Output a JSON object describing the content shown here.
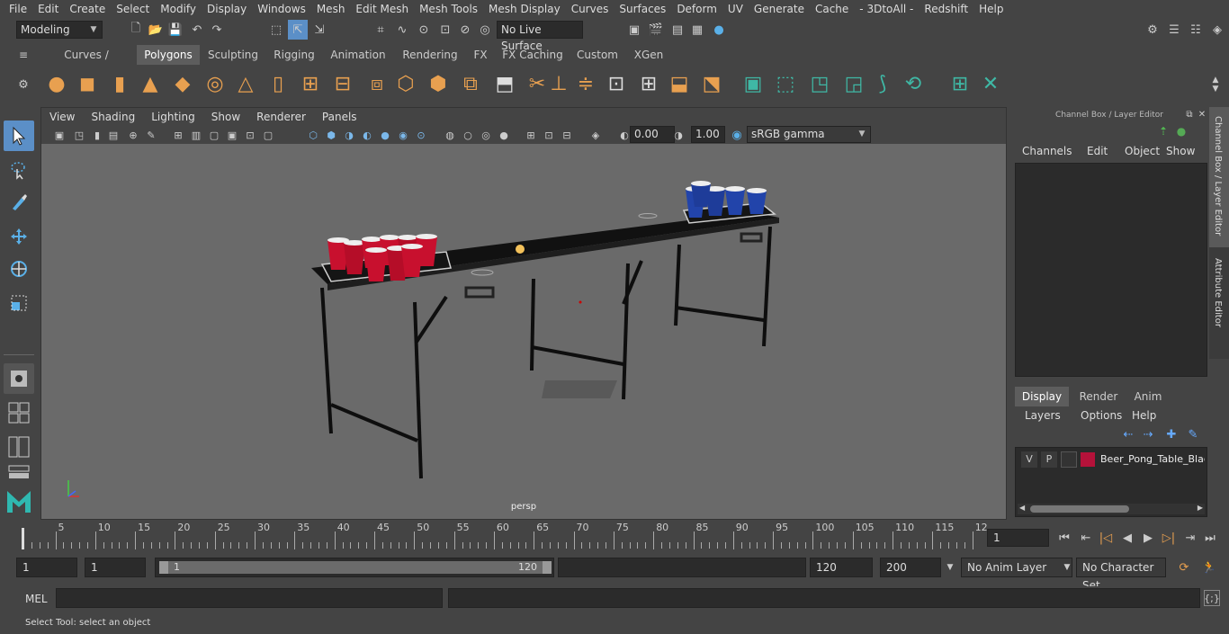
{
  "menubar": {
    "items": [
      "File",
      "Edit",
      "Create",
      "Select",
      "Modify",
      "Display",
      "Windows",
      "Mesh",
      "Edit Mesh",
      "Mesh Tools",
      "Mesh Display",
      "Curves",
      "Surfaces",
      "Deform",
      "UV",
      "Generate",
      "Cache",
      "- 3DtoAll -",
      "Redshift",
      "Help"
    ]
  },
  "statusline": {
    "mode": "Modeling",
    "live_surface": "No Live Surface"
  },
  "shelf": {
    "tabs": [
      "Curves / Surfaces",
      "Polygons",
      "Sculpting",
      "Rigging",
      "Animation",
      "Rendering",
      "FX",
      "FX Caching",
      "Custom",
      "XGen"
    ],
    "active_tab": "Polygons"
  },
  "viewport": {
    "menu": [
      "View",
      "Shading",
      "Lighting",
      "Show",
      "Renderer",
      "Panels"
    ],
    "exposure": "0.00",
    "gamma": "1.00",
    "color_space": "sRGB gamma",
    "camera_label": "persp"
  },
  "channel_box": {
    "title": "Channel Box / Layer Editor",
    "menu": [
      "Channels",
      "Edit",
      "Object",
      "Show"
    ],
    "side_tabs": [
      "Channel Box / Layer Editor",
      "Attribute Editor"
    ],
    "layer_tabs": [
      "Display",
      "Render",
      "Anim"
    ],
    "active_layer_tab": "Display",
    "layer_menu": [
      "Layers",
      "Options",
      "Help"
    ],
    "layer": {
      "v": "V",
      "p": "P",
      "name": "Beer_Pong_Table_Black",
      "color": "#b5123a"
    }
  },
  "timeline": {
    "ticks": [
      "5",
      "10",
      "15",
      "20",
      "25",
      "30",
      "35",
      "40",
      "45",
      "50",
      "55",
      "60",
      "65",
      "70",
      "75",
      "80",
      "85",
      "90",
      "95",
      "100",
      "105",
      "110",
      "115",
      "12"
    ],
    "start_label": "1",
    "current_frame": "1"
  },
  "range": {
    "start": "1",
    "playback_start": "1",
    "slider_start": "1",
    "slider_end": "120",
    "playback_end": "120",
    "end": "200",
    "anim_layer": "No Anim Layer",
    "character_set": "No Character Set"
  },
  "mel": {
    "label": "MEL"
  },
  "help": {
    "text": "Select Tool: select an object"
  },
  "colors": {
    "accent": "#5b8fc7",
    "shelf_orange": "#e8a050",
    "shelf_teal": "#3fb8a5",
    "red_cup": "#c8102e",
    "blue_cup": "#2244aa"
  }
}
